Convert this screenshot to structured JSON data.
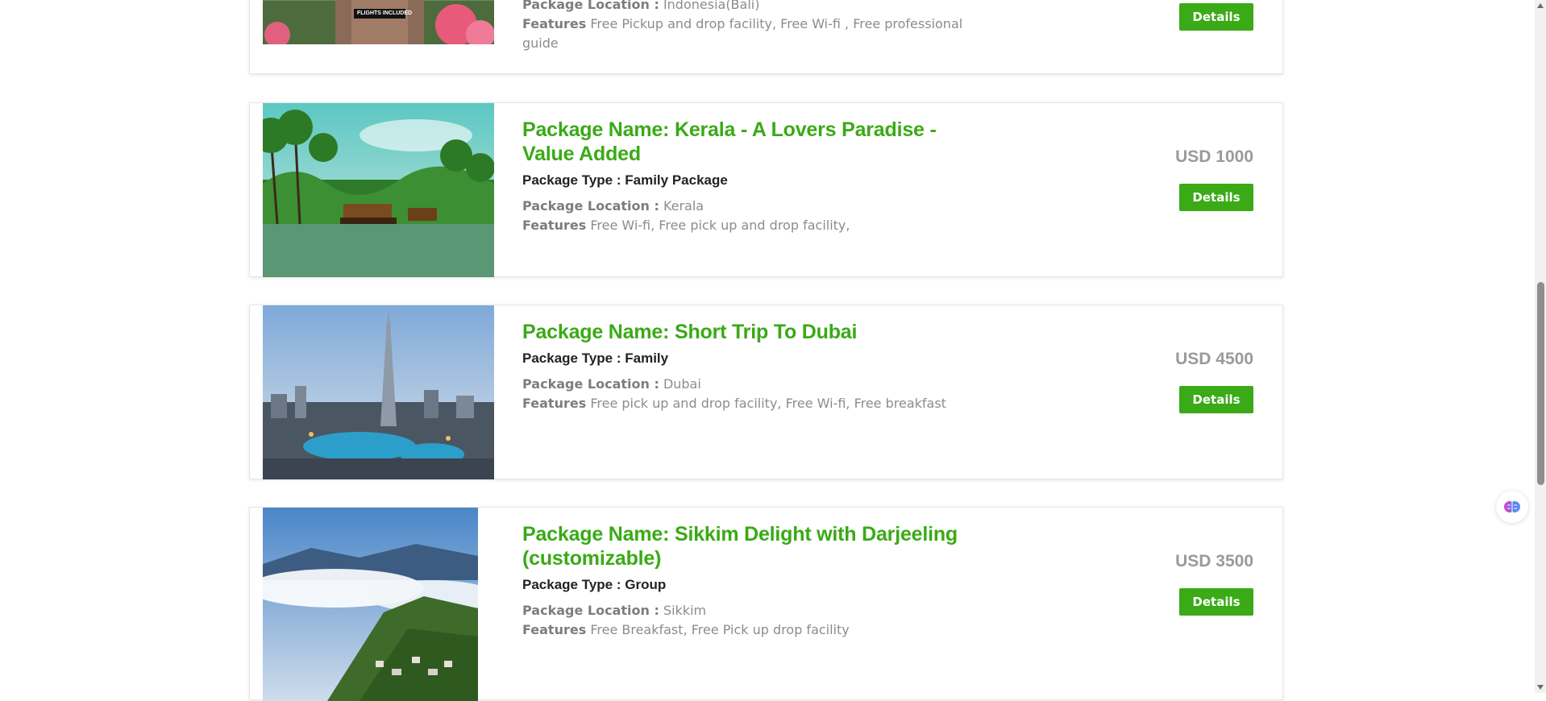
{
  "packages": [
    {
      "location_label": "Package Location :",
      "location": "Indonesia(Bali)",
      "features_label": "Features",
      "features": "Free Pickup and drop facility, Free Wi-fi , Free professional guide",
      "details_label": "Details",
      "image_caption": "FLIGHTS INCLUDED"
    },
    {
      "name": "Package Name: Kerala - A Lovers Paradise - Value Added",
      "type": "Package Type : Family Package",
      "location_label": "Package Location :",
      "location": "Kerala",
      "features_label": "Features",
      "features": "Free Wi-fi, Free pick up and drop facility,",
      "price": "USD 1000",
      "details_label": "Details"
    },
    {
      "name": "Package Name: Short Trip To Dubai",
      "type": "Package Type : Family",
      "location_label": "Package Location :",
      "location": "Dubai",
      "features_label": "Features",
      "features": "Free pick up and drop facility, Free Wi-fi, Free breakfast",
      "price": "USD 4500",
      "details_label": "Details"
    },
    {
      "name": "Package Name: Sikkim Delight with Darjeeling (customizable)",
      "type": "Package Type : Group",
      "location_label": "Package Location :",
      "location": "Sikkim",
      "features_label": "Features",
      "features": "Free Breakfast, Free Pick up drop facility",
      "price": "USD 3500",
      "details_label": "Details"
    }
  ],
  "colors": {
    "accent": "#3aaa16",
    "price": "#9a9a9a",
    "muted": "#8c8c8c"
  },
  "icons": {
    "assistant": "brain-icon",
    "scroll_up": "triangle-up-icon",
    "scroll_down": "triangle-down-icon"
  }
}
